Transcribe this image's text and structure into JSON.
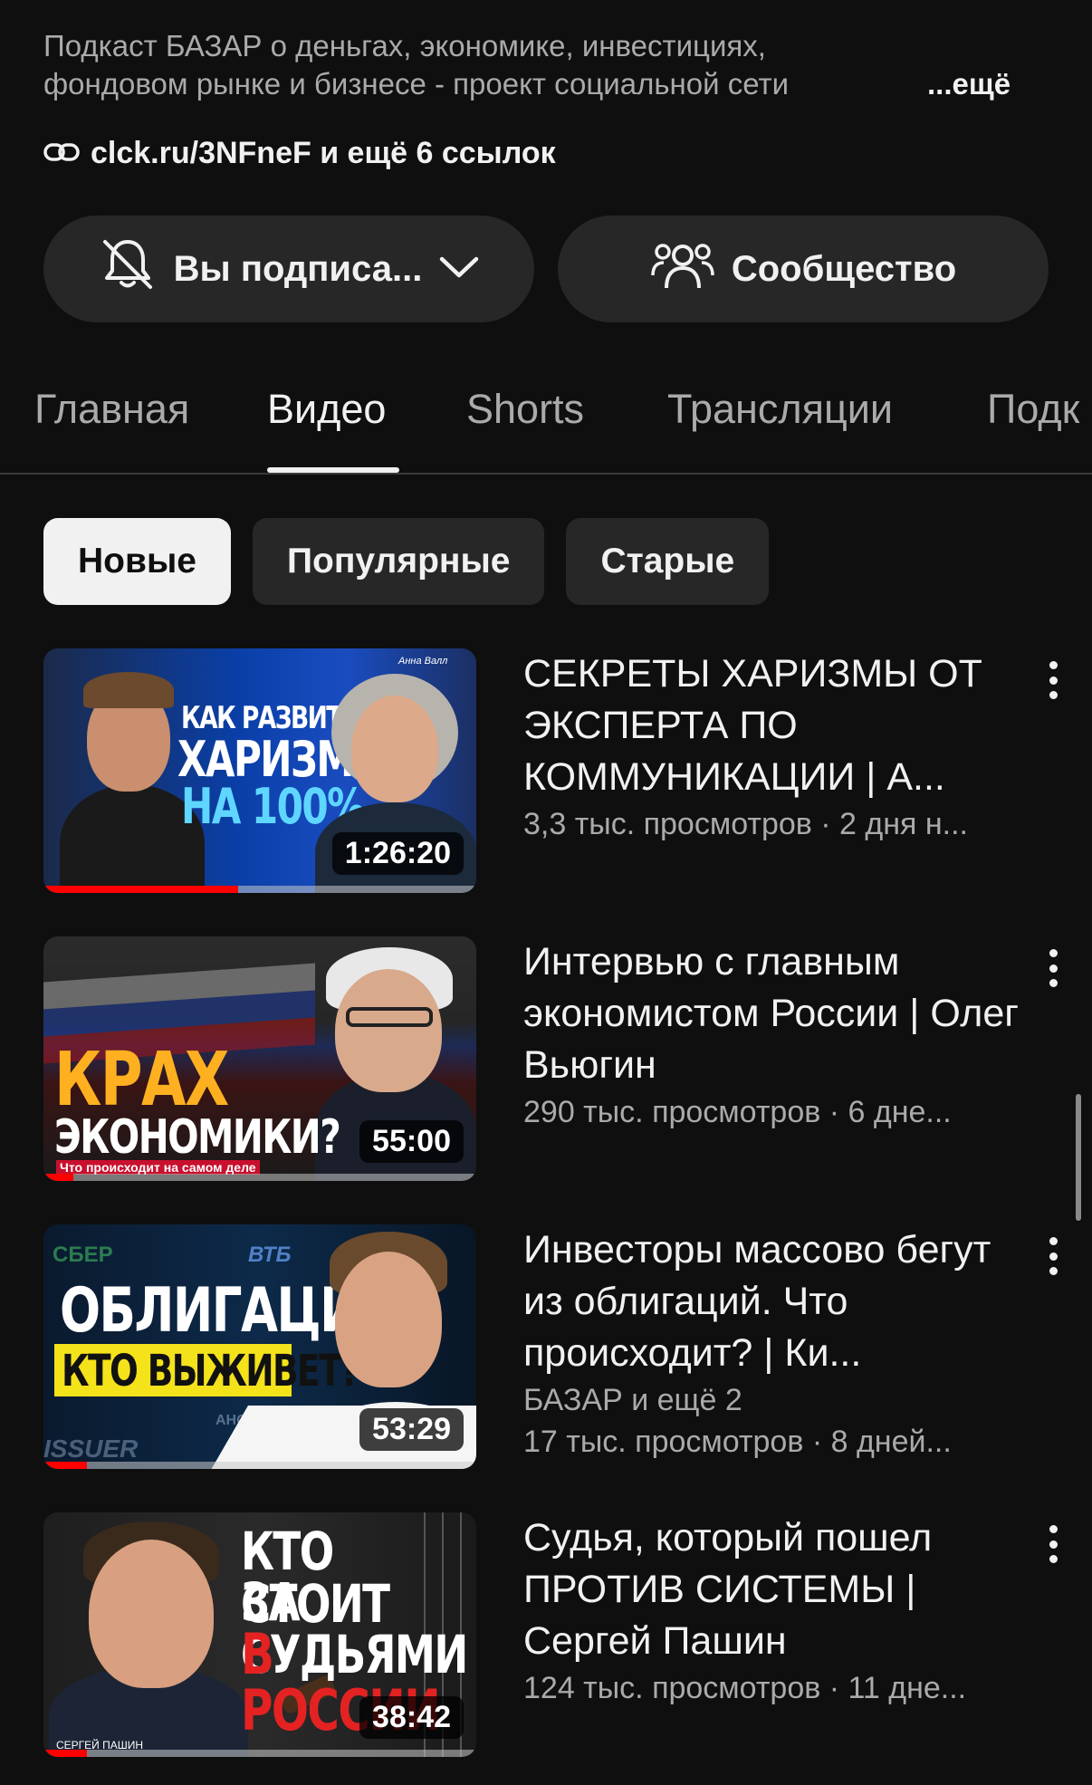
{
  "channel": {
    "description_line1": "Подкаст БАЗАР о деньгах, экономике, инвестициях,",
    "description_line2": "фондовом рынке и бизнесе - проект социальной сети",
    "description_more": "...ещё",
    "links_text": "clck.ru/3NFneF и ещё 6 ссылок",
    "subscribe_label": "Вы подписа...",
    "community_label": "Сообщество"
  },
  "tabs": [
    {
      "label": "Главная",
      "active": false
    },
    {
      "label": "Видео",
      "active": true
    },
    {
      "label": "Shorts",
      "active": false
    },
    {
      "label": "Трансляции",
      "active": false
    },
    {
      "label": "Подк",
      "active": false
    }
  ],
  "filters": [
    {
      "label": "Новые",
      "active": true
    },
    {
      "label": "Популярные",
      "active": false
    },
    {
      "label": "Старые",
      "active": false
    }
  ],
  "videos": [
    {
      "title": "СЕКРЕТЫ ХАРИЗМЫ ОТ ЭКСПЕРТА ПО КОММУНИКАЦИИ | А...",
      "meta": "3,3 тыс. просмотров · 2 дня н...",
      "duration": "1:26:20",
      "progress": 0.45,
      "thumb_text": [
        "КАК РАЗВИТЬ",
        "ХАРИЗМУ",
        "НА 100%"
      ],
      "thumb_small": "Анна Валл"
    },
    {
      "title": "Интервью с главным экономистом России | Олег Вьюгин",
      "meta": "290 тыс. просмотров · 6 дне...",
      "duration": "55:00",
      "progress": 0.07,
      "thumb_text": [
        "КРАХ",
        "ЭКОНОМИКИ?"
      ],
      "thumb_small": "Что происходит на самом деле"
    },
    {
      "title": "Инвесторы массово бегут из облигаций. Что происходит? | Ки...",
      "channel_line": "БАЗАР и ещё 2",
      "meta": "17 тыс. просмотров · 8 дней...",
      "duration": "53:29",
      "progress": 0.1,
      "thumb_text": [
        "ОБЛИГАЦИИ",
        "КТО ВЫЖИВЕТ?"
      ],
      "thumb_logos": [
        "СБЕР",
        "ВТБ",
        "АНОС",
        "ISSUER"
      ]
    },
    {
      "title": "Судья, который пошел ПРОТИВ СИСТЕМЫ | Сергей Пашин",
      "meta": "124 тыс. просмотров · 11 дне...",
      "duration": "38:42",
      "progress": 0.1,
      "thumb_text": [
        "КТО СТОИТ",
        "ЗА СУДЬЯМИ",
        "В РОССИИ"
      ],
      "thumb_small": "СЕРГЕЙ ПАШИН"
    }
  ]
}
